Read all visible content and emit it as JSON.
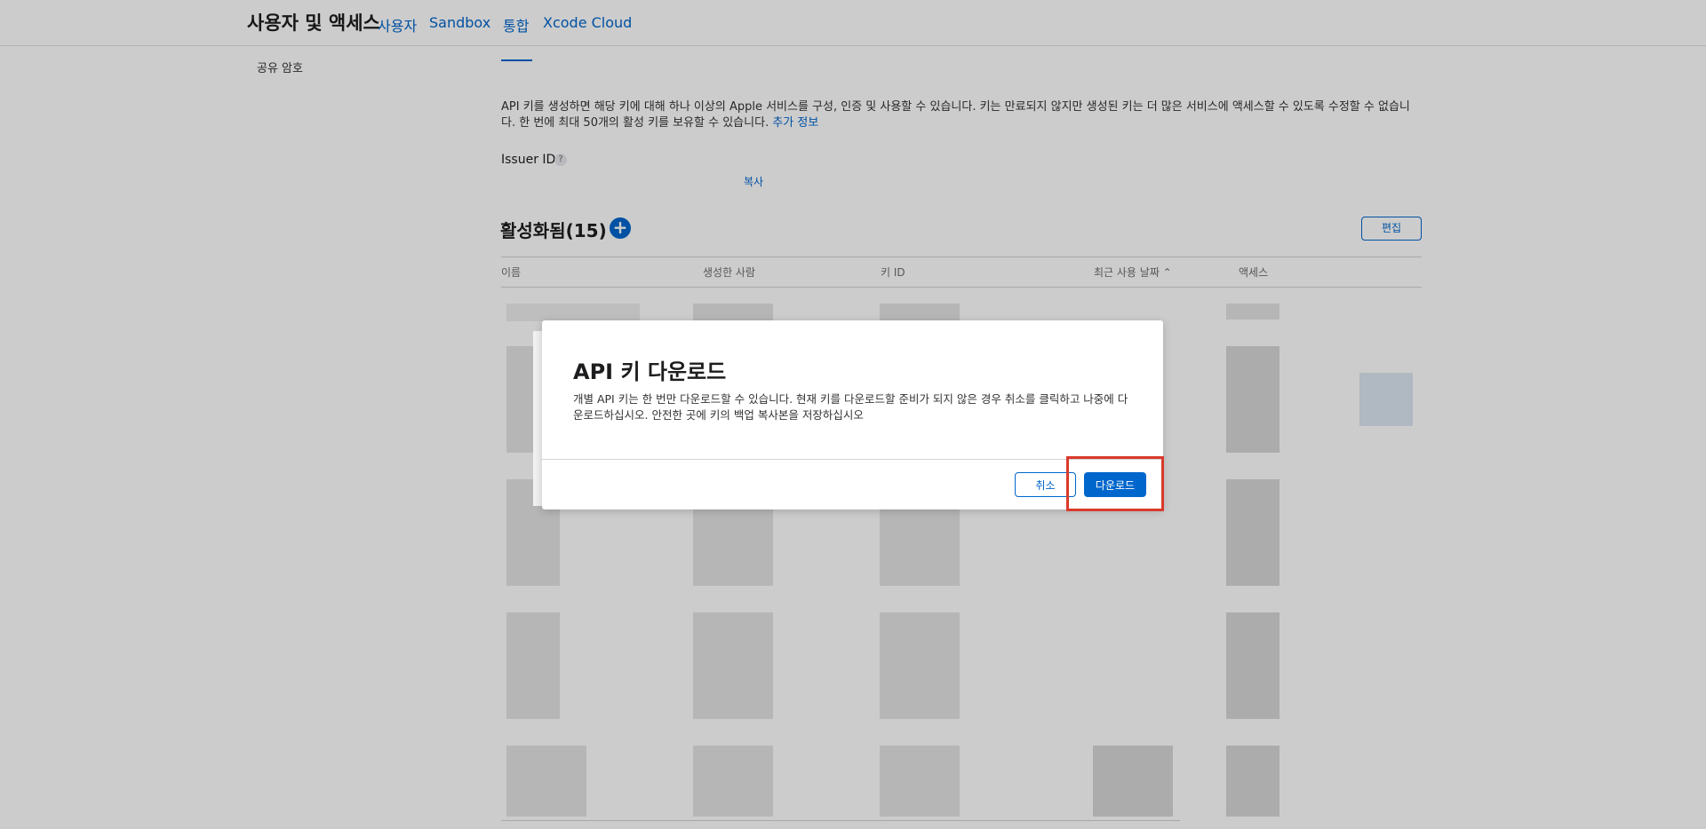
{
  "header": {
    "title": "사용자 및 액세스",
    "tabs": [
      {
        "label": "사용자"
      },
      {
        "label": "Sandbox"
      },
      {
        "label": "통합"
      },
      {
        "label": "Xcode Cloud"
      }
    ]
  },
  "sidebar": {
    "items": [
      {
        "label": "공유 암호"
      }
    ]
  },
  "main": {
    "description": "API 키를 생성하면 해당 키에 대해 하나 이상의 Apple 서비스를 구성, 인증 및 사용할 수 있습니다. 키는 만료되지 않지만 생성된 키는 더 많은 서비스에 액세스할 수 있도록 수정할 수 없습니다. 한 번에 최대 50개의 활성 키를 보유할 수 있습니다.",
    "more_info_link": "추가 정보",
    "issuer_label": "Issuer ID",
    "issuer_help": "?",
    "copy_link": "복사",
    "section_title": "활성화됨(15)",
    "add_icon": "+",
    "edit_label": "편집",
    "columns": [
      "이름",
      "생성한 사람",
      "키 ID",
      "최근 사용 날짜 ⌃",
      "액세스"
    ]
  },
  "dialog": {
    "title": "API 키 다운로드",
    "body": "개별 API 키는 한 번만 다운로드할 수 있습니다. 현재 키를 다운로드할 준비가 되지 않은 경우 취소를 클릭하고 나중에 다운로드하십시오. 안전한 곳에 키의 백업 복사본을 저장하십시오",
    "cancel_label": "취소",
    "download_label": "다운로드"
  },
  "colors": {
    "accent": "#0066cc",
    "highlight": "#d93a2b"
  }
}
